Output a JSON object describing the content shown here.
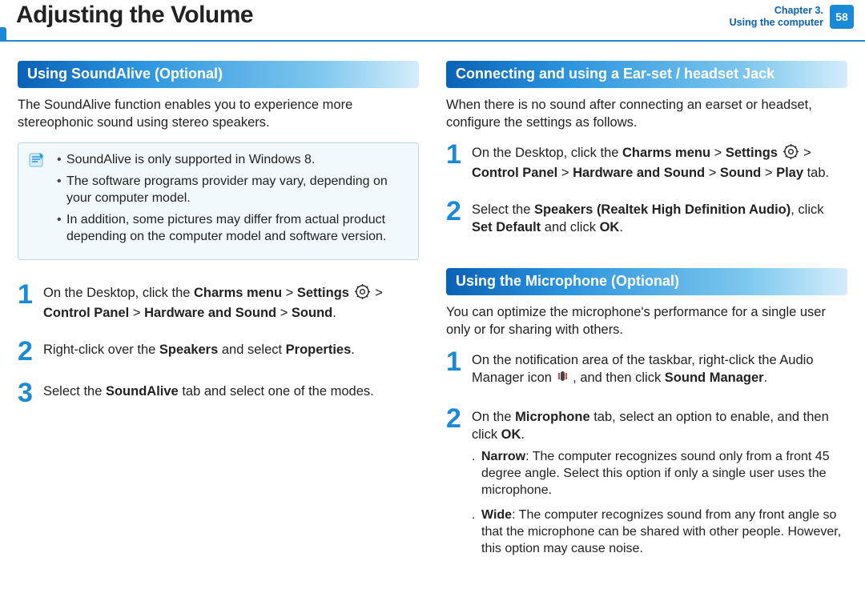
{
  "header": {
    "title": "Adjusting the Volume",
    "chapter_line1": "Chapter 3.",
    "chapter_line2": "Using the computer",
    "page_number": "58"
  },
  "left": {
    "section1_title": "Using SoundAlive (Optional)",
    "intro": "The SoundAlive function enables you to experience more stereophonic sound using stereo speakers.",
    "note1": "SoundAlive is only supported in Windows 8.",
    "note2": "The software programs provider may vary, depending on your computer model.",
    "note3": "In addition, some pictures may differ from actual product depending on the computer model and software version.",
    "step1_a": "On the Desktop, click the ",
    "step1_b": "Charms menu",
    "step1_c": " > ",
    "step1_d": "Settings",
    "step1_e": " > ",
    "step1_f": "Control Panel",
    "step1_g": " > ",
    "step1_h": "Hardware and Sound",
    "step1_i": " > ",
    "step1_j": "Sound",
    "step1_k": ".",
    "step2_a": "Right-click over the ",
    "step2_b": "Speakers",
    "step2_c": " and select ",
    "step2_d": "Properties",
    "step2_e": ".",
    "step3_a": "Select the ",
    "step3_b": "SoundAlive",
    "step3_c": " tab and select one of the modes."
  },
  "right": {
    "section1_title": "Connecting and using a Ear-set / headset Jack",
    "intro1": "When there is no sound after connecting an earset or headset, configure the settings as follows.",
    "s1_a": "On the Desktop, click the ",
    "s1_b": "Charms menu",
    "s1_c": " > ",
    "s1_d": "Settings",
    "s1_e": " > ",
    "s1_f": "Control Panel",
    "s1_g": " > ",
    "s1_h": "Hardware and Sound",
    "s1_i": " > ",
    "s1_j": "Sound",
    "s1_k": " > ",
    "s1_l": "Play",
    "s1_m": " tab.",
    "s2_a": "Select the ",
    "s2_b": "Speakers (Realtek High Definition Audio)",
    "s2_c": ", click ",
    "s2_d": "Set Default",
    "s2_e": " and click ",
    "s2_f": "OK",
    "s2_g": ".",
    "section2_title": "Using the Microphone (Optional)",
    "intro2": "You can optimize the microphone's performance for a single user only or for sharing with others.",
    "m1_a": "On the notification area of the taskbar, right-click the Audio Manager icon ",
    "m1_b": " , and then click ",
    "m1_c": "Sound Manager",
    "m1_d": ".",
    "m2_a": "On the ",
    "m2_b": "Microphone",
    "m2_c": " tab, select an option to enable, and then click ",
    "m2_d": "OK",
    "m2_e": ".",
    "narrow_label": "Narrow",
    "narrow_text": ": The computer recognizes sound only from a front 45 degree angle. Select this option if only a single user uses the microphone.",
    "wide_label": "Wide",
    "wide_text": ": The computer recognizes sound from any front angle so that the microphone can be shared with other people. However, this option may cause noise.",
    "dot": "."
  },
  "nums": {
    "n1": "1",
    "n2": "2",
    "n3": "3"
  }
}
